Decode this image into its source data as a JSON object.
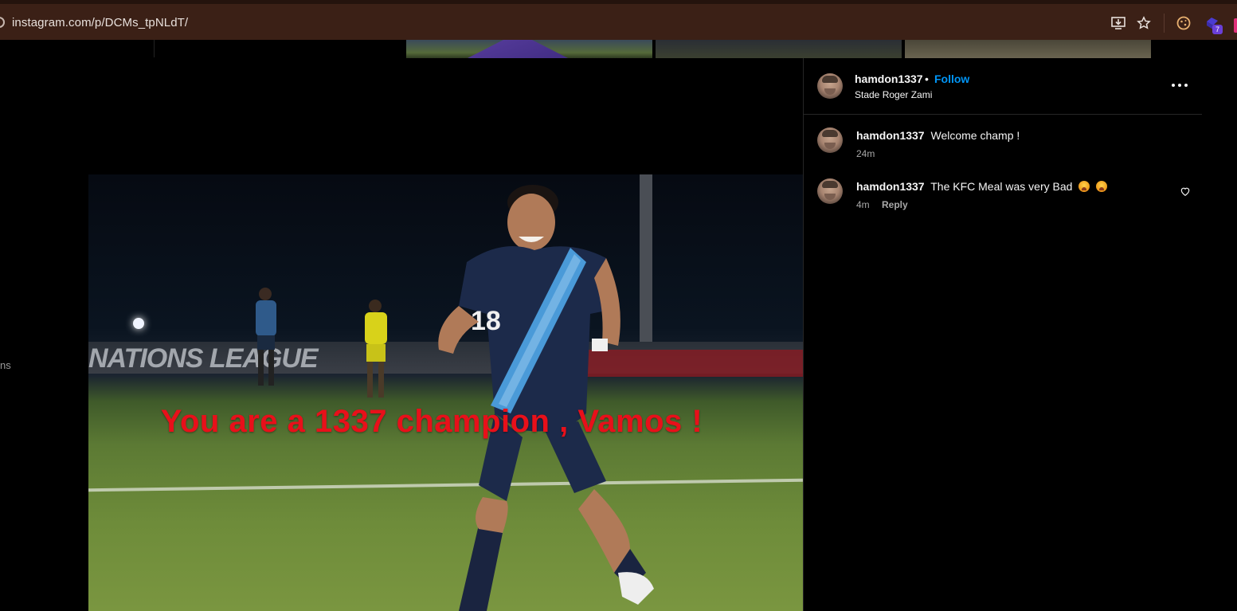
{
  "browser": {
    "url": "instagram.com/p/DCMs_tpNLdT/",
    "extension_badge": "7"
  },
  "sidebar": {
    "partial_text": "ns"
  },
  "post": {
    "overlay_text": "You are a 1337 champion , Vamos !",
    "banner_text": "NATIONS LEAGUE",
    "jersey_number": "18"
  },
  "header": {
    "username": "hamdon1337",
    "separator": "•",
    "follow_label": "Follow",
    "location": "Stade Roger Zami"
  },
  "comments": [
    {
      "username": "hamdon1337",
      "text": "Welcome champ !",
      "time": "24m",
      "reply_label": ""
    },
    {
      "username": "hamdon1337",
      "text": "The KFC Meal was very Bad",
      "time": "4m",
      "reply_label": "Reply"
    }
  ],
  "colors": {
    "follow": "#0095f6",
    "overlay_text": "#e8101a",
    "browser_bar": "#3b2016"
  },
  "icons": [
    "site-info-icon",
    "install-app-icon",
    "star-icon",
    "cookie-extension-icon",
    "puzzle-extension-icon",
    "more-options-icon",
    "heart-icon",
    "emoji-icon"
  ]
}
